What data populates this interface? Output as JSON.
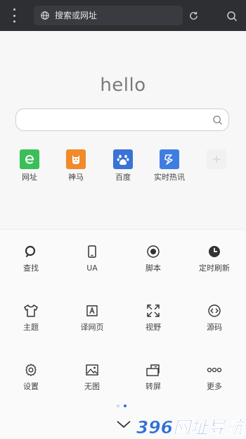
{
  "url_bar": {
    "placeholder": "搜索或网址"
  },
  "home": {
    "logo_text": "hello"
  },
  "shortcuts": [
    {
      "label": "网址",
      "icon": "e-icon",
      "color": "#3cbf5a"
    },
    {
      "label": "神马",
      "icon": "shenma-icon",
      "color": "#f08a2a"
    },
    {
      "label": "百度",
      "icon": "baidu-paw-icon",
      "color": "#3a73d6"
    },
    {
      "label": "实时热讯",
      "icon": "flash-icon",
      "color": "#3f7ee0"
    }
  ],
  "tools": [
    {
      "label": "查找",
      "icon": "search-icon"
    },
    {
      "label": "UA",
      "icon": "phone-icon"
    },
    {
      "label": "脚本",
      "icon": "record-icon"
    },
    {
      "label": "定时刷新",
      "icon": "clock-icon"
    },
    {
      "label": "主题",
      "icon": "shirt-icon"
    },
    {
      "label": "译网页",
      "icon": "translate-icon"
    },
    {
      "label": "视野",
      "icon": "fullscreen-icon"
    },
    {
      "label": "源码",
      "icon": "code-icon"
    },
    {
      "label": "设置",
      "icon": "gear-icon"
    },
    {
      "label": "无图",
      "icon": "image-icon"
    },
    {
      "label": "转屏",
      "icon": "rotate-screen-icon"
    },
    {
      "label": "更多",
      "icon": "more-dots-icon"
    }
  ],
  "watermark": {
    "text": "396网址导航"
  },
  "colors": {
    "topbar": "#2e2f33",
    "accent": "#2f6fd6",
    "watermark": "#2f6fd6"
  }
}
